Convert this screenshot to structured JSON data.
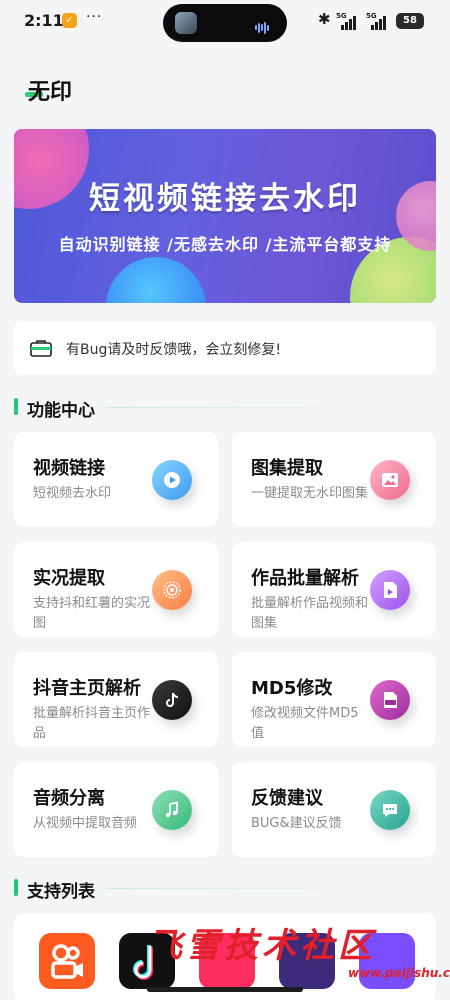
{
  "status_bar": {
    "time": "2:11",
    "app_badge": "✓",
    "more": "···",
    "network_1": "5G",
    "network_2": "5G",
    "battery": "58"
  },
  "app": {
    "title": "无印"
  },
  "banner": {
    "title": "短视频链接去水印",
    "subtitle": "自动识别链接 /无感去水印 /主流平台都支持"
  },
  "notice": {
    "text": "有Bug请及时反馈哦，会立刻修复!",
    "icon": "toolbox-icon"
  },
  "features_section": {
    "label": "功能中心",
    "cards": [
      {
        "title": "视频链接",
        "sub": "短视频去水印",
        "icon": "play-icon",
        "colors": [
          "#8ad4ff",
          "#3c9bf0"
        ]
      },
      {
        "title": "图集提取",
        "sub": "一键提取无水印图集",
        "icon": "image-icon",
        "colors": [
          "#ffb3c6",
          "#f06c8e"
        ]
      },
      {
        "title": "实况提取",
        "sub": "支持抖和红薯的实况图",
        "icon": "live-photo-icon",
        "colors": [
          "#ffc089",
          "#fb7b45"
        ]
      },
      {
        "title": "作品批量解析",
        "sub": "批量解析作品视频和图集",
        "icon": "video-file-icon",
        "colors": [
          "#d4a0ff",
          "#9a52ea"
        ]
      },
      {
        "title": "抖音主页解析",
        "sub": "批量解析抖音主页作品",
        "icon": "tiktok-icon",
        "colors": [
          "#3b3b3b",
          "#111111"
        ]
      },
      {
        "title": "MD5修改",
        "sub": "修改视频文件MD5值",
        "icon": "md5-file-icon",
        "colors": [
          "#e06ccf",
          "#9d2b9c"
        ]
      },
      {
        "title": "音频分离",
        "sub": "从视频中提取音频",
        "icon": "music-icon",
        "colors": [
          "#8fe0b5",
          "#35b97a"
        ]
      },
      {
        "title": "反馈建议",
        "sub": "BUG&建议反馈",
        "icon": "chat-icon",
        "colors": [
          "#7ad7c6",
          "#24a58f"
        ]
      }
    ]
  },
  "support_section": {
    "label": "支持列表",
    "apps": [
      {
        "name": "kuaishou-logo",
        "color": "#ff5a1f"
      },
      {
        "name": "douyin-logo",
        "color": "#111111"
      },
      {
        "name": "platform-logo-3",
        "color": "#ff2e5f"
      },
      {
        "name": "platform-logo-4",
        "color": "#3c2a7a"
      },
      {
        "name": "platform-logo-5",
        "color": "#7a4dff"
      }
    ]
  },
  "watermark": {
    "text": "飞雪技术社区",
    "url": "www.paijishu.com"
  }
}
